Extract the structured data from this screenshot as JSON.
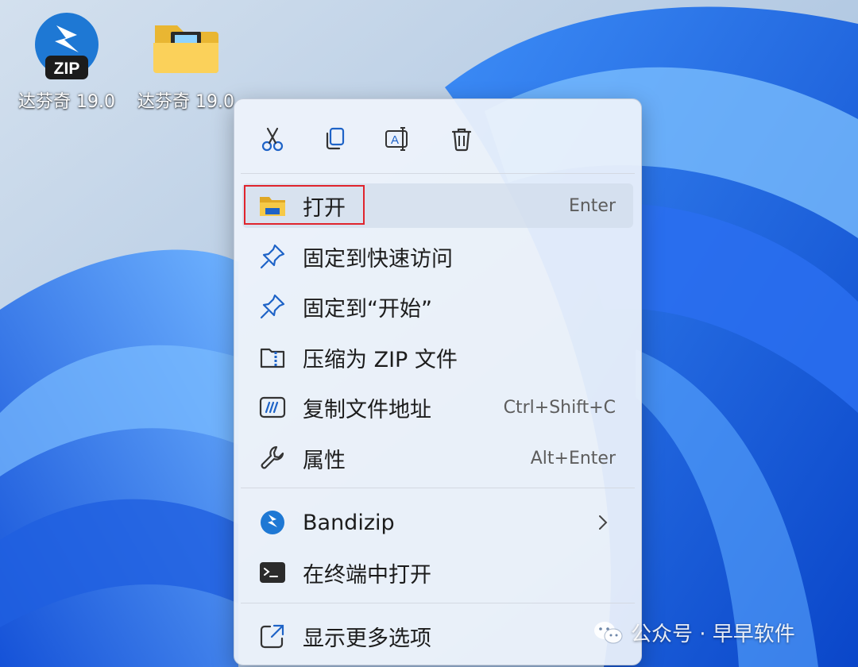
{
  "desktop": {
    "icons": [
      {
        "label": "达芬奇 19.0",
        "badge": "ZIP",
        "icon": "bandizip-zip-icon"
      },
      {
        "label": "达芬奇 19.0",
        "icon": "folder-icon"
      }
    ]
  },
  "context_menu": {
    "toolbar": [
      {
        "name": "cut",
        "icon": "scissors-icon"
      },
      {
        "name": "copy",
        "icon": "copy-icon"
      },
      {
        "name": "rename",
        "icon": "rename-icon"
      },
      {
        "name": "delete",
        "icon": "trash-icon"
      }
    ],
    "items": [
      {
        "label": "打开",
        "shortcut": "Enter",
        "icon": "folder-open-icon",
        "highlighted": true
      },
      {
        "label": "固定到快速访问",
        "shortcut": "",
        "icon": "pin-icon"
      },
      {
        "label": "固定到“开始”",
        "shortcut": "",
        "icon": "pin-icon"
      },
      {
        "label": "压缩为 ZIP 文件",
        "shortcut": "",
        "icon": "zip-folder-icon"
      },
      {
        "label": "复制文件地址",
        "shortcut": "Ctrl+Shift+C",
        "icon": "copy-path-icon"
      },
      {
        "label": "属性",
        "shortcut": "Alt+Enter",
        "icon": "wrench-icon"
      },
      {
        "label": "Bandizip",
        "shortcut": "",
        "icon": "bandizip-icon",
        "submenu": true
      },
      {
        "label": "在终端中打开",
        "shortcut": "",
        "icon": "terminal-icon"
      },
      {
        "label": "显示更多选项",
        "shortcut": "",
        "icon": "show-more-icon"
      }
    ]
  },
  "watermark": {
    "text": "公众号 · 早早软件",
    "icon": "wechat-icon"
  },
  "colors": {
    "accent": "#1e78d4",
    "highlight_border": "#e0242d",
    "folder": "#f5c542"
  }
}
